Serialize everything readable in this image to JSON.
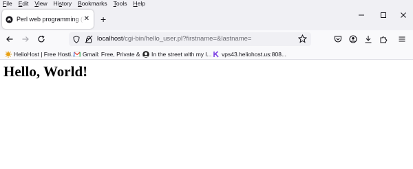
{
  "menubar": {
    "items": [
      {
        "mnemonic": "F",
        "rest": "ile"
      },
      {
        "mnemonic": "E",
        "rest": "dit"
      },
      {
        "mnemonic": "V",
        "rest": "iew"
      },
      {
        "pre": "Hi",
        "mnemonic": "s",
        "rest": "tory"
      },
      {
        "mnemonic": "B",
        "rest": "ookmarks"
      },
      {
        "mnemonic": "T",
        "rest": "ools"
      },
      {
        "mnemonic": "H",
        "rest": "elp"
      }
    ]
  },
  "tab": {
    "title": "Perl web programming (Perl scripts)",
    "close_glyph": "✕",
    "new_tab_glyph": "+"
  },
  "urlbar": {
    "host": "localhost",
    "path": "/cgi-bin/hello_user.pl?firstname=&lastname="
  },
  "bookmarks": [
    {
      "label": "HelioHost | Free Hosti...",
      "icon": "heliohost-icon",
      "color": "#e8a013"
    },
    {
      "label": "Gmail: Free, Private & ...",
      "icon": "gmail-icon",
      "color": "#ea4335"
    },
    {
      "label": "In the street with my l...",
      "icon": "profile-head-icon",
      "color": "#222222"
    },
    {
      "label": "vps43.heliohost.us:808...",
      "icon": "k-logo-icon",
      "color": "#7b3fe4"
    }
  ],
  "content": {
    "heading": "Hello, World!"
  },
  "colors": {
    "chrome_bg": "#f0f0f4",
    "toolbar_bg": "#f9f9fb",
    "text": "#15141a",
    "url_path": "#6b6b72"
  }
}
